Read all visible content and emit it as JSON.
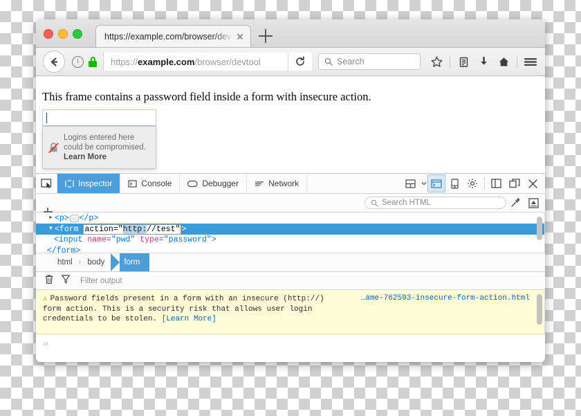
{
  "window": {
    "traffic_lights": [
      "close",
      "minimize",
      "maximize"
    ]
  },
  "tab": {
    "title": "https://example.com/browser/dev",
    "close_label": "×",
    "newtab_label": "+"
  },
  "navbar": {
    "back_label": "Back",
    "info_label": "i",
    "lock_label": "Secure connection",
    "url_prefix": "https://",
    "url_domain": "example.com",
    "url_path": "/browser/devtool",
    "reload_label": "Reload",
    "search_placeholder": "Search",
    "icons": [
      "star-icon",
      "library-icon",
      "downloads-icon",
      "home-icon",
      "menu-icon"
    ]
  },
  "page": {
    "heading": "This frame contains a password field inside a form with insecure action.",
    "password_value": "",
    "insecure_popup": {
      "line1": "Logins entered here",
      "line2": "could be compromised.",
      "learn_more": "Learn More",
      "icon": "broken-lock-icon"
    }
  },
  "devtools": {
    "picker_icon": "element-picker-icon",
    "tabs": [
      {
        "label": "Inspector",
        "icon": "inspector-icon",
        "active": true
      },
      {
        "label": "Console",
        "icon": "console-icon",
        "active": false
      },
      {
        "label": "Debugger",
        "icon": "debugger-icon",
        "active": false
      },
      {
        "label": "Network",
        "icon": "network-icon",
        "active": false
      }
    ],
    "right_icons": [
      "layout-split-icon",
      "chevron-down-icon",
      "split-console-icon",
      "responsive-design-icon",
      "settings-gear-icon",
      "dock-side-icon",
      "dock-window-icon",
      "close-icon"
    ],
    "search_html_placeholder": "Search HTML",
    "eyedropper_icon": "eyedropper-icon",
    "screenshot_icon": "screenshot-node-icon",
    "markup": {
      "row_p": {
        "open": "<p>",
        "ellipsis": "…",
        "close": "</p>"
      },
      "row_form_open": {
        "tag_open": "<form",
        "attr_name": "action=\"",
        "attr_value_selected": "http:",
        "attr_value_rest": "//test\"",
        "tag_close": ">"
      },
      "row_input": {
        "tag": "<input",
        "attr1_name": "name=",
        "attr1_value": "\"pwd\"",
        "attr2_name": "type=",
        "attr2_value": "\"password\"",
        "tag_close": ">"
      },
      "row_form_close": "</form>"
    },
    "breadcrumbs": [
      {
        "label": "html",
        "active": false
      },
      {
        "label": "body",
        "active": false
      },
      {
        "label": "form",
        "active": true
      }
    ],
    "breadcrumb_separator": "›",
    "console": {
      "trash_icon": "trash-icon",
      "filter_icon": "filter-icon",
      "filter_placeholder": "Filter output",
      "warning_symbol": "⚠",
      "message_part1": "Password fields present in a form with an insecure (http://) form action. This is a security risk that allows user login credentials to be stolen. ",
      "message_link": "[Learn More]",
      "source_file": "…ame-762593-insecure-form-action.html",
      "prompt": "»"
    }
  },
  "colors": {
    "accent_blue": "#4c9ed9",
    "tag_blue": "#0074e8",
    "attr_pink": "#ee2b75",
    "warn_bg": "#fffcd8",
    "link_blue": "#0c61c1",
    "lock_green": "#12bc00"
  }
}
